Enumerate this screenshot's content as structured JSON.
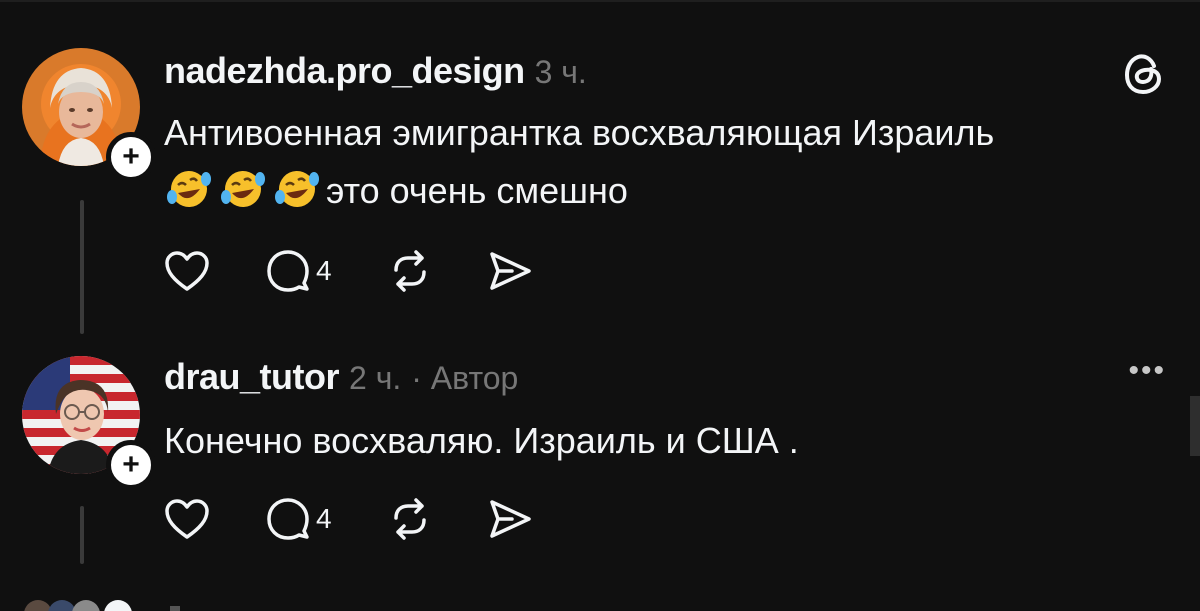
{
  "posts": [
    {
      "username": "nadezhda.pro_design",
      "time": "3 ч.",
      "extra": "",
      "text_line1": "Антивоенная эмигрантка восхваляющая Израиль",
      "emojis": [
        "🤣",
        "🤣",
        "🤣"
      ],
      "text_line2": "это очень смешно",
      "reply_count": "4",
      "corner_icon": "threads-logo-icon"
    },
    {
      "username": "drau_tutor",
      "time": "2 ч.",
      "extra": "· Автор",
      "text_line1": "Конечно восхваляю. Израиль и США .",
      "reply_count": "4",
      "corner_icon": "more-options-icon"
    }
  ],
  "colors": {
    "background": "#101010",
    "text": "#f3f5f7",
    "muted": "#777777",
    "thread_line": "#3a3a3a"
  }
}
